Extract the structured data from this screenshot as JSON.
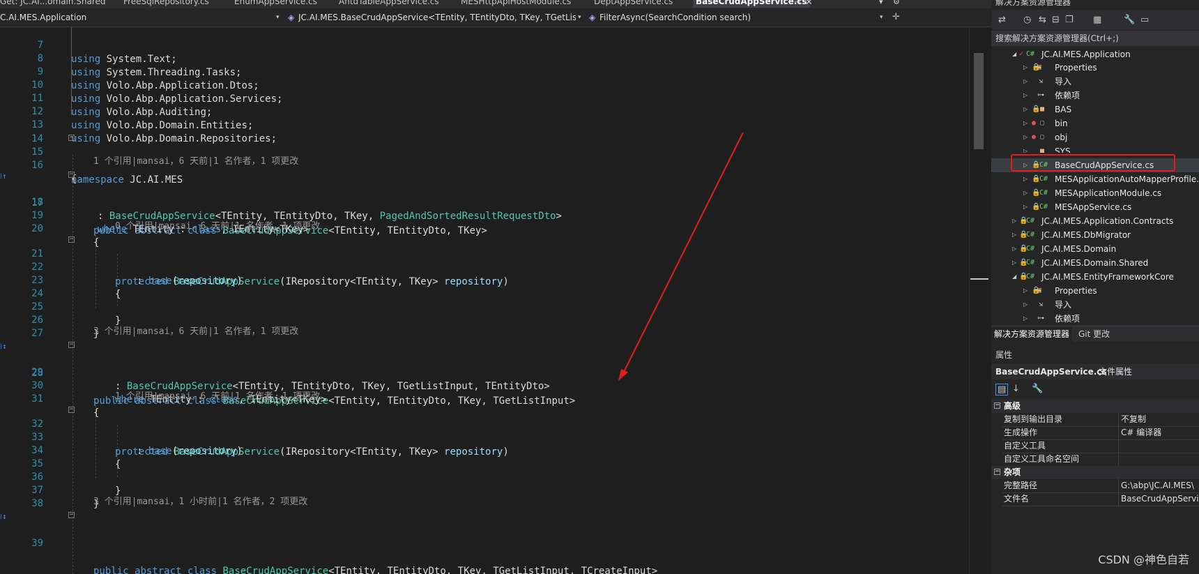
{
  "tabs": [
    {
      "label": "Get: JC.AI...omain.Shared",
      "active": false
    },
    {
      "label": "FreeSqlRepository.cs",
      "active": false
    },
    {
      "label": "EnumAppService.cs",
      "active": false
    },
    {
      "label": "AntdTableAppService.cs",
      "active": false
    },
    {
      "label": "MESHttpApiHostModule.cs",
      "active": false
    },
    {
      "label": "DeptAppService.cs",
      "active": false
    },
    {
      "label": "BaseCrudAppService.cs",
      "active": true
    }
  ],
  "nav": {
    "project": "C.AI.MES.Application",
    "type": "JC.AI.MES.BaseCrudAppService<TEntity, TEntityDto, TKey, TGetListInput, TC",
    "member": "FilterAsync(SearchCondition search)"
  },
  "code": {
    "line_numbers": [
      "7",
      "8",
      "9",
      "10",
      "11",
      "12",
      "13",
      "14",
      "15",
      "16",
      "17",
      "18",
      "19",
      "20",
      "21",
      "22",
      "23",
      "24",
      "25",
      "26",
      "27",
      "28",
      "29",
      "30",
      "31",
      "32",
      "33",
      "34",
      "35",
      "36",
      "37",
      "38",
      "39"
    ],
    "usings": [
      [
        "using",
        "System.Text;"
      ],
      [
        "using",
        "System.Threading.Tasks;"
      ],
      [
        "using",
        "Volo.Abp.Application.Dtos;"
      ],
      [
        "using",
        "Volo.Abp.Application.Services;"
      ],
      [
        "using",
        "Volo.Abp.Auditing;"
      ],
      [
        "using",
        "Volo.Abp.Domain.Entities;"
      ],
      [
        "using",
        "Volo.Abp.Domain.Repositories;"
      ]
    ],
    "lens": {
      "c1": "1 个引用|mansai，6 天前|1 名作者，1 项更改",
      "c2": "0 个引用|mansai，6 天前|1 名作者，1 项更改",
      "c3": "3 个引用|mansai，6 天前|1 名作者，1 项更改",
      "c4": "1 个引用|mansai，6 天前|1 名作者，1 项更改",
      "c5": "3 个引用|mansai，1 小时前|1 名作者，2 项更改"
    },
    "kw": {
      "namespace": "namespace",
      "public": "public",
      "abstract": "abstract",
      "class": "class",
      "where": "where",
      "protected": "protected",
      "base": "base"
    },
    "ns_name": "JC.AI.MES",
    "type_name": "BaseCrudAppService",
    "repo_param": "repository"
  },
  "solution_explorer": {
    "title": "解决方案资源管理器",
    "search_placeholder": "搜索解决方案资源管理器(Ctrl+;)",
    "items": [
      {
        "label": "JC.AI.MES.Application",
        "icon": "C#"
      },
      {
        "label": "Properties",
        "icon": "folder-wrench"
      },
      {
        "label": "导入",
        "icon": "import"
      },
      {
        "label": "依赖项",
        "icon": "dependencies"
      },
      {
        "label": "BAS",
        "icon": "folder"
      },
      {
        "label": "bin",
        "icon": "folder-dashed"
      },
      {
        "label": "obj",
        "icon": "folder-dashed"
      },
      {
        "label": "SYS",
        "icon": "folder"
      },
      {
        "label": "BaseCrudAppService.cs",
        "icon": "C#"
      },
      {
        "label": "MESApplicationAutoMapperProfile.c",
        "icon": "C#"
      },
      {
        "label": "MESApplicationModule.cs",
        "icon": "C#"
      },
      {
        "label": "MESAppService.cs",
        "icon": "C#"
      },
      {
        "label": "JC.AI.MES.Application.Contracts",
        "icon": "C#"
      },
      {
        "label": "JC.AI.MES.DbMigrator",
        "icon": "C#"
      },
      {
        "label": "JC.AI.MES.Domain",
        "icon": "C#"
      },
      {
        "label": "JC.AI.MES.Domain.Shared",
        "icon": "C#"
      },
      {
        "label": "JC.AI.MES.EntityFrameworkCore",
        "icon": "C#"
      },
      {
        "label": "Properties",
        "icon": "folder-wrench"
      },
      {
        "label": "导入",
        "icon": "import"
      },
      {
        "label": "依赖项",
        "icon": "dependencies"
      }
    ],
    "tabs": [
      "解决方案资源管理器",
      "Git 更改"
    ]
  },
  "properties": {
    "title": "属性",
    "object_name": "BaseCrudAppService.cs",
    "object_kind": "文件属性",
    "categories": [
      {
        "name": "高级",
        "rows": [
          [
            "复制到输出目录",
            "不复制"
          ],
          [
            "生成操作",
            "C# 编译器"
          ],
          [
            "自定义工具",
            ""
          ],
          [
            "自定义工具命名空间",
            ""
          ]
        ]
      },
      {
        "name": "杂项",
        "rows": [
          [
            "完整路径",
            "G:\\abp\\JC.AI.MES\\"
          ],
          [
            "文件名",
            "BaseCrudAppServi"
          ]
        ]
      }
    ]
  },
  "watermark": "CSDN @神色自若",
  "colors": {
    "keyword": "#569cd6",
    "type": "#4ec9b0",
    "param": "#9cdcfe",
    "highlight_box": "#e51c1c",
    "annotation_arrow": "#e51c1c"
  }
}
